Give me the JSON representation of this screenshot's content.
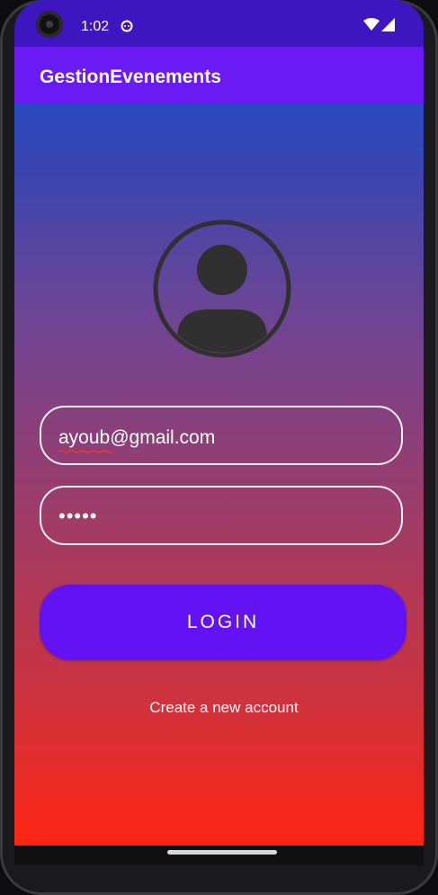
{
  "status_bar": {
    "time": "1:02",
    "app_icon": "android-head-icon",
    "wifi_icon": "wifi-icon",
    "signal_icon": "cell-signal-icon"
  },
  "app_bar": {
    "title": "GestionEvenements",
    "color": "#6a1af2"
  },
  "avatar": {
    "icon": "person-circle-icon"
  },
  "login_form": {
    "email_value": "ayoub@gmail.com",
    "password_value": "•••••",
    "login_label": "LOGIN",
    "create_account_label": "Create a new account"
  },
  "colors": {
    "status_bar": "#3e16c0",
    "button": "#6312f3",
    "gradient_top": "#1150dd",
    "gradient_bottom": "#ff2412"
  }
}
